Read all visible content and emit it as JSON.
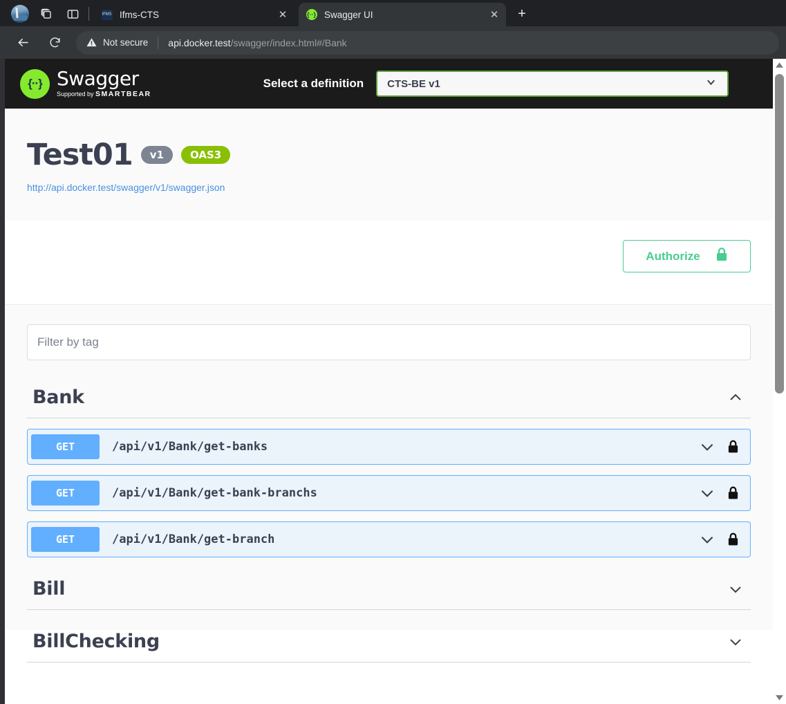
{
  "browser": {
    "toolbar_icons": [
      "profile-avatar",
      "tab-groups-icon",
      "split-screen-icon"
    ],
    "tabs": [
      {
        "title": "Ifms-CTS",
        "favicon": "ifms-favicon",
        "favicon_text": "IFMS",
        "active": false,
        "close_label": "✕"
      },
      {
        "title": "Swagger UI",
        "favicon": "swagger-favicon",
        "favicon_text": "{··}",
        "active": true,
        "close_label": "✕"
      }
    ],
    "new_tab_label": "+",
    "back_label": "←",
    "reload_label": "↻",
    "security_text": "Not secure",
    "url_domain": "api.docker.test",
    "url_path": "/swagger/index.html#/Bank"
  },
  "swagger": {
    "logo_glyph": "{··}",
    "logo_name": "Swagger",
    "logo_supported_prefix": "Supported by ",
    "logo_supported_brand": "SMARTBEAR",
    "select_definition_label": "Select a definition",
    "definition_selected": "CTS-BE v1",
    "info": {
      "title": "Test01",
      "version_badge": "v1",
      "oas_badge": "OAS3",
      "spec_url": "http://api.docker.test/swagger/v1/swagger.json"
    },
    "authorize": {
      "label": "Authorize",
      "icon": "lock-icon",
      "color": "#49cc90"
    },
    "filter": {
      "placeholder": "Filter by tag",
      "value": ""
    },
    "tags": [
      {
        "name": "Bank",
        "expanded": true,
        "toggle_icon": "chevron-up-icon",
        "operations": [
          {
            "method": "GET",
            "path": "/api/v1/Bank/get-banks",
            "secured": true,
            "expand_icon": "chevron-down-icon",
            "lock_icon": "lock-icon"
          },
          {
            "method": "GET",
            "path": "/api/v1/Bank/get-bank-branchs",
            "secured": true,
            "expand_icon": "chevron-down-icon",
            "lock_icon": "lock-icon"
          },
          {
            "method": "GET",
            "path": "/api/v1/Bank/get-branch",
            "secured": true,
            "expand_icon": "chevron-down-icon",
            "lock_icon": "lock-icon"
          }
        ]
      },
      {
        "name": "Bill",
        "expanded": false,
        "toggle_icon": "chevron-down-icon",
        "operations": []
      },
      {
        "name": "BillChecking",
        "expanded": false,
        "toggle_icon": "chevron-down-icon",
        "operations": []
      }
    ],
    "colors": {
      "get_method": "#61affe",
      "oas_badge": "#89bf04",
      "version_badge": "#7d8492",
      "authorize_green": "#49cc90",
      "link_blue": "#4990e2",
      "topbar_bg": "#1b1b1b"
    }
  },
  "scrollbar": {
    "up_label": "▲",
    "down_label": "▼"
  }
}
